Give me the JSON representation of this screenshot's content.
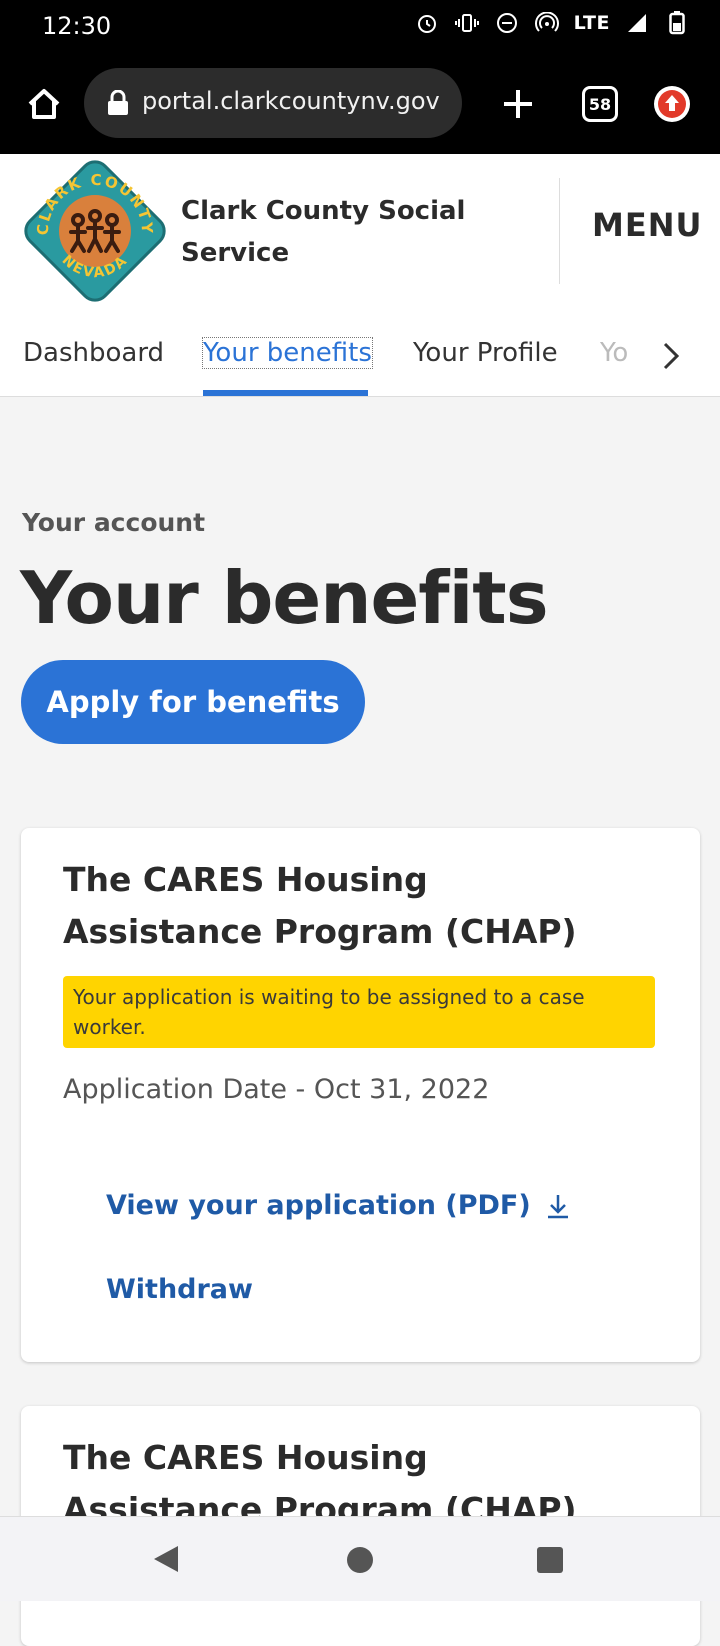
{
  "status_bar": {
    "time": "12:30",
    "network": "LTE",
    "icons": [
      "alarm-icon",
      "vibrate-icon",
      "dnd-icon",
      "hotspot-icon",
      "signal-icon",
      "battery-icon"
    ]
  },
  "browser": {
    "url": "portal.clarkcountynv.gov",
    "tab_count": "58"
  },
  "header": {
    "org_name": "Clark County Social Service",
    "menu_label": "MENU",
    "logo_text": {
      "top": "CLARK COUNTY",
      "bottom": "NEVADA"
    }
  },
  "nav": {
    "tabs": [
      {
        "label": "Dashboard"
      },
      {
        "label": "Your benefits",
        "active": true
      },
      {
        "label": "Your Profile"
      },
      {
        "label": "Yo"
      }
    ]
  },
  "main": {
    "eyebrow": "Your account",
    "title": "Your benefits",
    "apply_label": "Apply for benefits"
  },
  "cards": [
    {
      "title": "The CARES Housing Assistance Program (CHAP)",
      "status": "Your application is waiting to be assigned to a case worker.",
      "date": "Application Date - Oct 31, 2022",
      "view_label": "View your application (PDF)",
      "withdraw_label": "Withdraw"
    },
    {
      "title": "The CARES Housing Assistance Program (CHAP)"
    }
  ],
  "colors": {
    "accent": "#2b73d6",
    "link": "#1f5aa6",
    "badge": "#ffd400"
  }
}
